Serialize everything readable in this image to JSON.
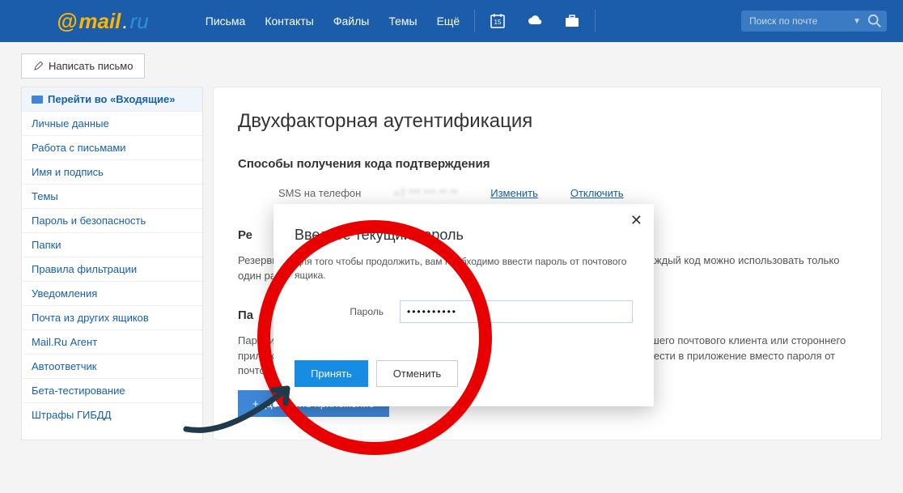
{
  "topnav": {
    "logo": {
      "at": "@",
      "name": "mail",
      "dot": ".",
      "tld": "ru"
    },
    "links": [
      "Письма",
      "Контакты",
      "Файлы",
      "Темы",
      "Ещё"
    ],
    "search_placeholder": "Поиск по почте"
  },
  "compose_label": "Написать письмо",
  "sidebar": [
    "Перейти во «Входящие»",
    "Личные данные",
    "Работа с письмами",
    "Имя и подпись",
    "Темы",
    "Пароль и безопасность",
    "Папки",
    "Правила фильтрации",
    "Уведомления",
    "Почта из других ящиков",
    "Mail.Ru Агент",
    "Автоответчик",
    "Бета-тестирование",
    "Штрафы ГИБДД"
  ],
  "main": {
    "title": "Двухфакторная аутентификация",
    "methods_heading": "Способы получения кода подтверждения",
    "sms_label": "SMS на телефон",
    "sms_value": "+7 *** *** ** **",
    "change_link": "Изменить",
    "disable_link": "Отключить",
    "reserve_heading": "Ре",
    "reserve_body": "Резервные коды пригодятся, если у вас нет доступа к телефону или приложению. Каждый код можно использовать только один раз. Рекомендуем также удалять старые аннулированные коды.",
    "apps_heading": "Па",
    "apps_body1": "Пароли приложений — это коды доступа, которые нужны для корректной работы вашего почтового клиента или стороннего приложения (The Bat!, Outlook или почтовое приложение в iPhone). Код требуется ввести в приложение вместо пароля от почтового ящика при первом входе в Почту.",
    "add_app_btn": "Добавить приложение"
  },
  "modal": {
    "title": "Введите текущий пароль",
    "body": "Для того чтобы продолжить, вам необходимо ввести пароль от почтового ящика.",
    "field_label": "Пароль",
    "password_value": "••••••••••",
    "accept": "Принять",
    "cancel": "Отменить"
  }
}
